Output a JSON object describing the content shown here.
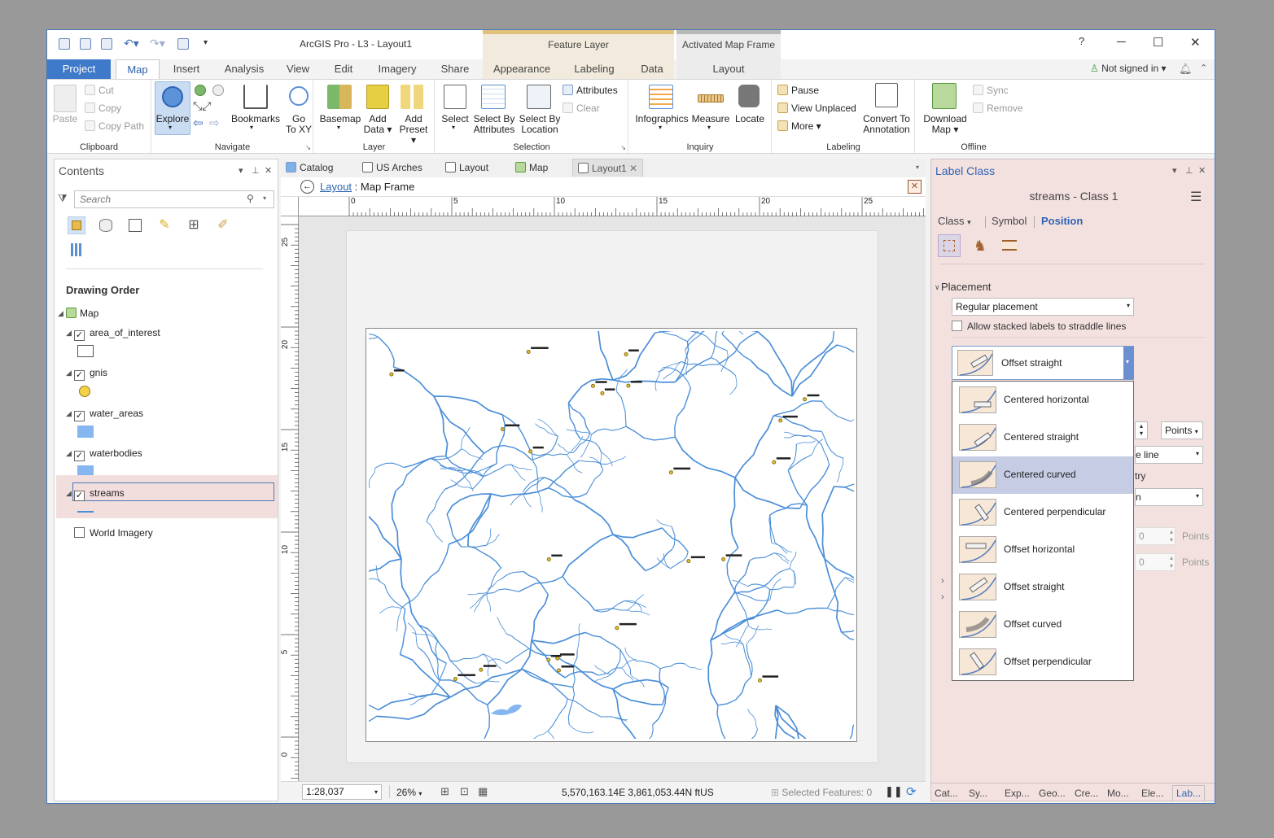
{
  "window": {
    "title": "ArcGIS Pro - L3 - Layout1",
    "context_feature_layer": "Feature Layer",
    "context_map_frame": "Activated Map Frame"
  },
  "titlebar": {
    "help": "?",
    "minimize": "─",
    "maximize": "☐",
    "close": "✕"
  },
  "tabs": [
    "Project",
    "Map",
    "Insert",
    "Analysis",
    "View",
    "Edit",
    "Imagery",
    "Share",
    "Appearance",
    "Labeling",
    "Data",
    "Layout"
  ],
  "user": {
    "status": "Not signed in"
  },
  "ribbon": {
    "clipboard": {
      "label": "Clipboard",
      "paste": "Paste",
      "cut": "Cut",
      "copy": "Copy",
      "copy_path": "Copy Path"
    },
    "navigate": {
      "label": "Navigate",
      "explore": "Explore",
      "bookmarks": "Bookmarks",
      "goto_xy_1": "Go",
      "goto_xy_2": "To XY"
    },
    "layer": {
      "label": "Layer",
      "basemap": "Basemap",
      "add_data_1": "Add",
      "add_data_2": "Data",
      "add_preset_1": "Add",
      "add_preset_2": "Preset"
    },
    "selection": {
      "label": "Selection",
      "select": "Select",
      "select_attr_1": "Select By",
      "select_attr_2": "Attributes",
      "select_loc_1": "Select By",
      "select_loc_2": "Location",
      "attributes": "Attributes",
      "clear": "Clear"
    },
    "inquiry": {
      "label": "Inquiry",
      "infographics": "Infographics",
      "measure": "Measure",
      "locate": "Locate"
    },
    "labeling": {
      "label": "Labeling",
      "pause": "Pause",
      "view_unplaced": "View Unplaced",
      "more": "More",
      "convert_1": "Convert To",
      "convert_2": "Annotation"
    },
    "offline": {
      "label": "Offline",
      "download_1": "Download",
      "download_2": "Map",
      "sync": "Sync",
      "remove": "Remove"
    }
  },
  "contents": {
    "title": "Contents",
    "search_placeholder": "Search",
    "drawing_order": "Drawing Order",
    "map": "Map",
    "layers": [
      {
        "name": "area_of_interest",
        "checked": true
      },
      {
        "name": "gnis",
        "checked": true
      },
      {
        "name": "water_areas",
        "checked": true
      },
      {
        "name": "waterbodies",
        "checked": true
      },
      {
        "name": "streams",
        "checked": true
      },
      {
        "name": "World Imagery",
        "checked": false
      }
    ]
  },
  "doc_tabs": [
    "Catalog",
    "US Arches",
    "Layout",
    "Map",
    "Layout1"
  ],
  "viewbar": {
    "breadcrumb_link": "Layout",
    "breadcrumb_rest": " : Map Frame"
  },
  "ruler": {
    "h_ticks": [
      "0",
      "5",
      "10",
      "15",
      "20",
      "25"
    ],
    "v_ticks": [
      "25",
      "20",
      "15",
      "10",
      "5",
      "0"
    ]
  },
  "status": {
    "scale": "1:28,037",
    "zoom": "26%",
    "coords": "5,570,163.14E 3,861,053.44N ftUS",
    "selected": "Selected Features: 0"
  },
  "label_class": {
    "title": "Label Class",
    "subtitle": "streams - Class 1",
    "tabs": [
      "Class",
      "Symbol",
      "Position"
    ],
    "placement_title": "Placement",
    "placement_value": "Regular placement",
    "allow_stacked": "Allow stacked labels to straddle lines",
    "position_value": "Offset straight",
    "options": [
      "Centered horizontal",
      "Centered straight",
      "Centered curved",
      "Centered perpendicular",
      "Offset horizontal",
      "Offset straight",
      "Offset curved",
      "Offset perpendicular"
    ],
    "selected_option": "Centered curved",
    "partial_points_1": "Points",
    "partial_line": "e line",
    "partial_try": "try",
    "partial_n": "n",
    "partial_val_1": "0",
    "partial_val_2": "0",
    "partial_points_2": "Points",
    "partial_points_3": "Points",
    "bottom_tabs": [
      "Cat...",
      "Sy...",
      "Exp...",
      "Geo...",
      "Cre...",
      "Mo...",
      "Ele...",
      "Lab..."
    ]
  },
  "colors": {
    "accent": "#3f79c9",
    "stream": "#4a8ed8",
    "panel_pink": "#f3e1e0"
  }
}
